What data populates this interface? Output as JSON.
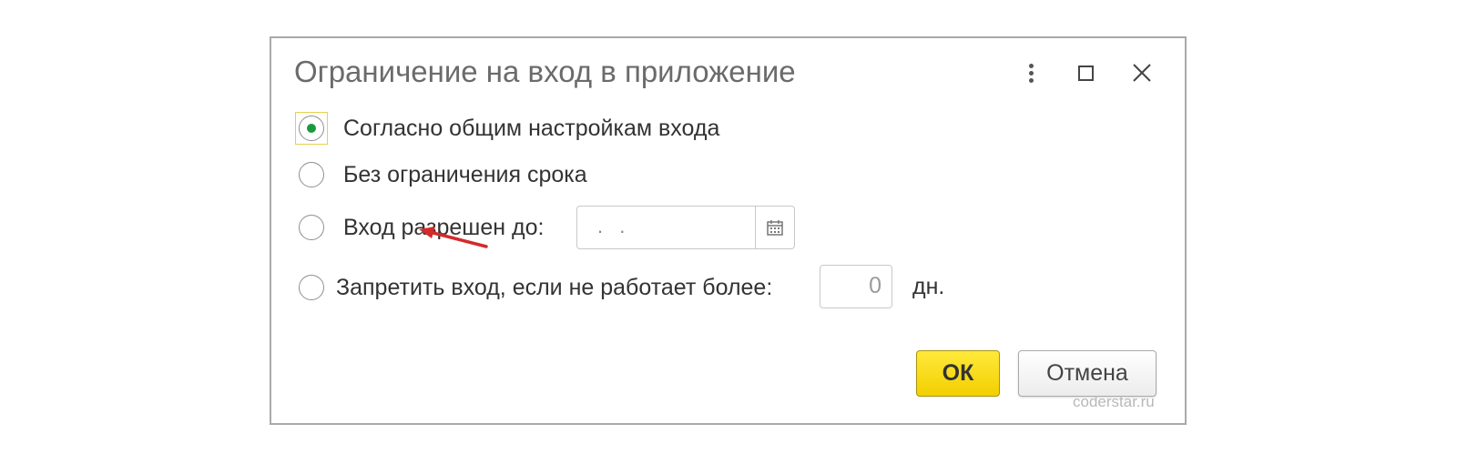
{
  "dialog": {
    "title": "Ограничение на вход в приложение",
    "header_icons": [
      "more-vertical-icon",
      "maximize-icon",
      "close-icon"
    ]
  },
  "options": [
    {
      "label": "Согласно общим настройкам входа",
      "selected": true
    },
    {
      "label": "Без ограничения срока",
      "selected": false
    },
    {
      "label": "Вход разрешен до:",
      "selected": false
    },
    {
      "label": "Запретить вход, если не работает более:",
      "selected": false
    }
  ],
  "date_field": {
    "value": ". .",
    "icon": "calendar-icon"
  },
  "days_field": {
    "value": "0",
    "unit": "дн."
  },
  "buttons": {
    "ok": "ОК",
    "cancel": "Отмена"
  },
  "watermark": "coderstar.ru",
  "colors": {
    "accent_ok": "#f8d800",
    "radio_selected": "#1a9a3f",
    "focus_border": "#e8cf4e",
    "annotation_arrow": "#d42a2a"
  }
}
